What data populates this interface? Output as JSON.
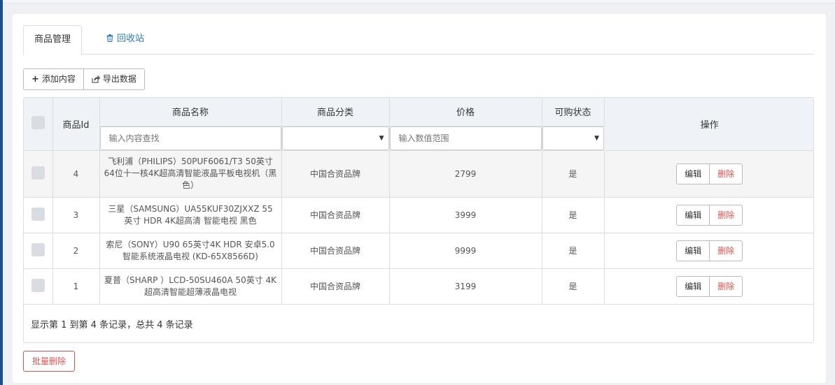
{
  "tabs": [
    {
      "label": "商品管理",
      "active": true
    },
    {
      "label": "回收站",
      "icon": "trash-icon"
    }
  ],
  "toolbar": {
    "add_label": "添加内容",
    "add_icon": "plus-icon",
    "export_label": "导出数据",
    "export_icon": "share-icon"
  },
  "table": {
    "columns": {
      "id": "商品Id",
      "name": "商品名称",
      "category": "商品分类",
      "price": "价格",
      "status": "可购状态",
      "actions": "操作"
    },
    "filters": {
      "name_placeholder": "输入内容查找",
      "price_placeholder": "输入数值范围"
    },
    "rows": [
      {
        "id": "4",
        "name": "飞利浦（PHILIPS）50PUF6061/T3 50英寸64位十一核4K超高清智能液晶平板电视机（黑色）",
        "category": "中国合资品牌",
        "price": "2799",
        "status": "是"
      },
      {
        "id": "3",
        "name": "三星（SAMSUNG）UA55KUF30ZJXXZ 55英寸 HDR 4K超高清 智能电视 黑色",
        "category": "中国合资品牌",
        "price": "3999",
        "status": "是"
      },
      {
        "id": "2",
        "name": "索尼（SONY）U90 65英寸4K HDR 安卓5.0智能系统液晶电视 (KD-65X8566D)",
        "category": "中国合资品牌",
        "price": "9999",
        "status": "是"
      },
      {
        "id": "1",
        "name": "夏普（SHARP ）LCD-50SU460A 50英寸 4K超高清智能超薄液晶电视",
        "category": "中国合资品牌",
        "price": "3199",
        "status": "是"
      }
    ],
    "edit_label": "编辑",
    "delete_label": "删除",
    "summary": "显示第 1 到第 4 条记录，总共 4 条记录"
  },
  "batch_delete_label": "批量删除",
  "colors": {
    "accent": "#2a7ab8",
    "danger": "#d9534f",
    "header_bg": "#eff2f7"
  }
}
